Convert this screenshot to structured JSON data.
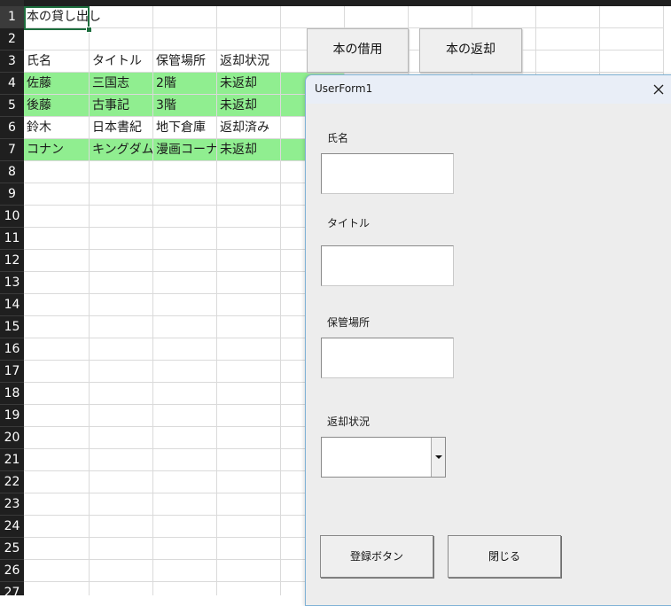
{
  "sheet": {
    "row_numbers": [
      "1",
      "2",
      "3",
      "4",
      "5",
      "6",
      "7",
      "8",
      "9",
      "10",
      "11",
      "12",
      "13",
      "14",
      "15",
      "16",
      "17",
      "18",
      "19",
      "20",
      "21",
      "22",
      "23",
      "24",
      "25",
      "26",
      "27"
    ],
    "title": "本の貸し出し",
    "headers": [
      "氏名",
      "タイトル",
      "保管場所",
      "返却状況"
    ],
    "rows": [
      [
        "佐藤",
        "三国志",
        "2階",
        "未返却"
      ],
      [
        "後藤",
        "古事記",
        "3階",
        "未返却"
      ],
      [
        "鈴木",
        "日本書紀",
        "地下倉庫",
        "返却済み"
      ],
      [
        "コナン",
        "キングダム",
        "漫画コーナー",
        "未返却"
      ]
    ],
    "buttons": {
      "borrow": "本の借用",
      "return": "本の返却"
    }
  },
  "userform": {
    "title": "UserForm1",
    "labels": {
      "name": "氏名",
      "title": "タイトル",
      "location": "保管場所",
      "status": "返却状況"
    },
    "values": {
      "name": "",
      "title": "",
      "location": "",
      "status": ""
    },
    "buttons": {
      "register": "登録ボタン",
      "close": "閉じる"
    }
  }
}
